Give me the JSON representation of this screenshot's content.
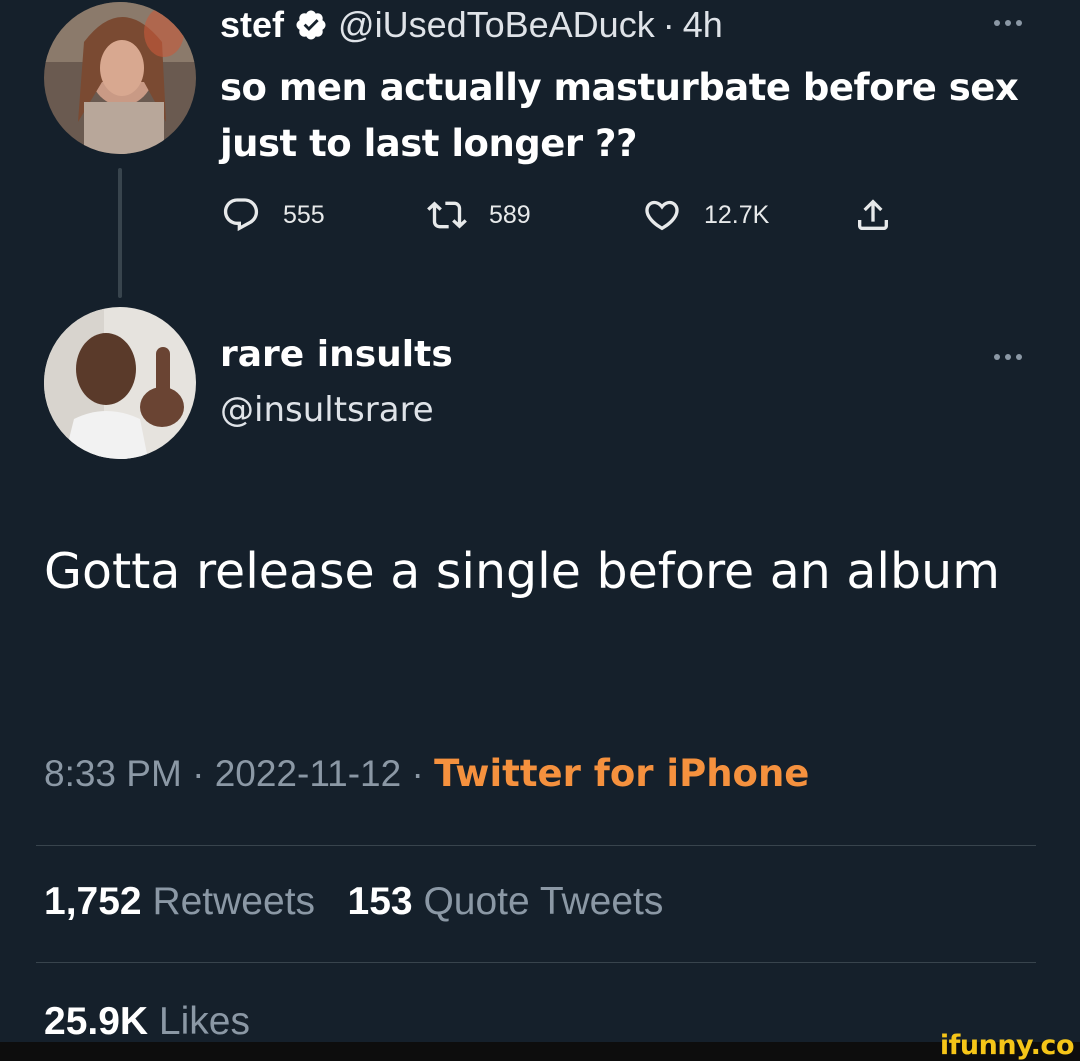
{
  "parent_tweet": {
    "display_name": "stef",
    "handle": "@iUsedToBeADuck",
    "separator": "·",
    "time": "4h",
    "text": "so men actually masturbate before sex just to last longer ??",
    "replies": "555",
    "retweets": "589",
    "likes": "12.7K",
    "icons": [
      "verified-badge-icon",
      "more-icon",
      "reply-icon",
      "retweet-icon",
      "like-icon",
      "share-icon"
    ]
  },
  "main_tweet": {
    "display_name": "rare insults",
    "handle": "@insultsrare",
    "text": "Gotta release a single before an album",
    "time": "8:33 PM",
    "separator": "·",
    "date": "2022-11-12",
    "source": "Twitter for iPhone",
    "retweet_count": "1,752",
    "retweet_label": "Retweets",
    "quote_count": "153",
    "quote_label": "Quote Tweets",
    "like_count": "25.9K",
    "like_label": "Likes"
  },
  "watermark": "ifunny.co",
  "colors": {
    "background": "#15202b",
    "muted_text": "#8b98a5",
    "source_orange": "#f5913e",
    "verified_blue": "#ffffff"
  }
}
